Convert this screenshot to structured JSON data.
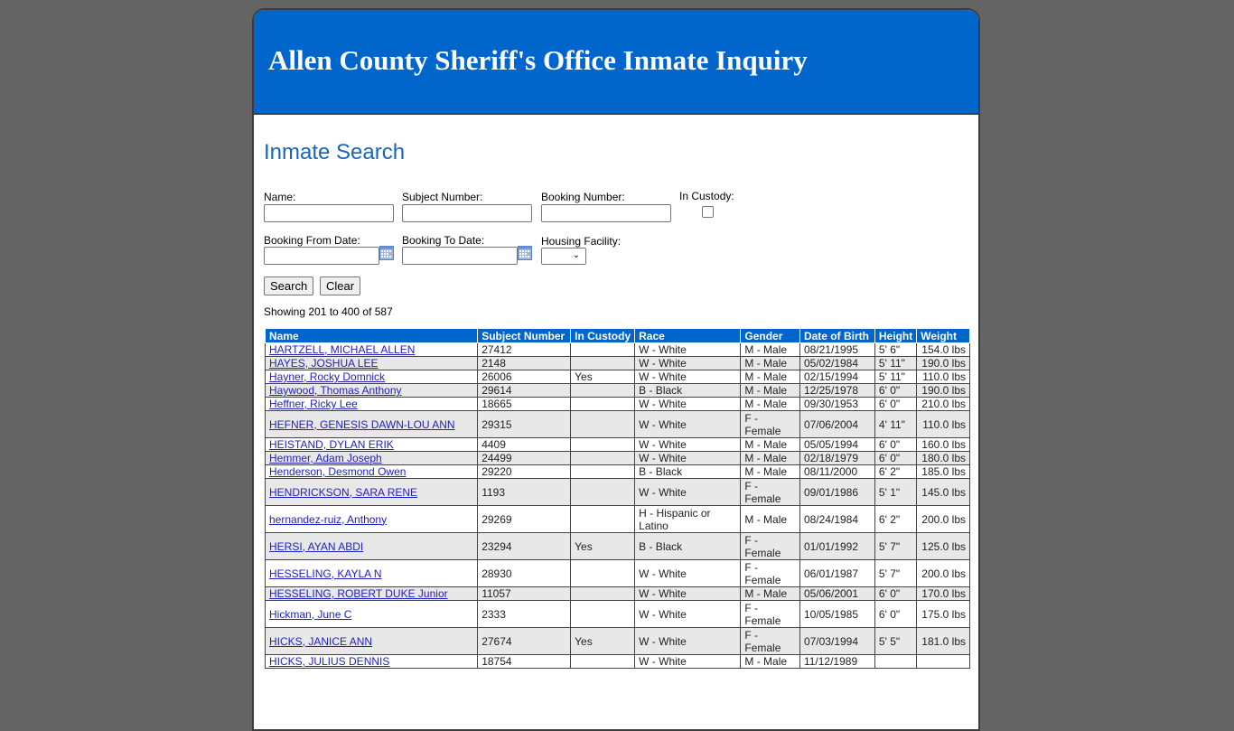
{
  "header": {
    "title": "Allen County Sheriff's Office Inmate Inquiry"
  },
  "search": {
    "section_title": "Inmate Search",
    "fields": {
      "name": {
        "label": "Name:",
        "value": ""
      },
      "subject_number": {
        "label": "Subject Number:",
        "value": ""
      },
      "booking_number": {
        "label": "Booking Number:",
        "value": ""
      },
      "in_custody": {
        "label": "In Custody:",
        "checked": false
      },
      "booking_from_date": {
        "label": "Booking From Date:",
        "value": ""
      },
      "booking_to_date": {
        "label": "Booking To Date:",
        "value": ""
      },
      "housing_facility": {
        "label": "Housing Facility:",
        "selected": ""
      }
    },
    "buttons": {
      "search": "Search",
      "clear": "Clear"
    },
    "icons": {
      "calendar": "calendar-icon",
      "dropdown": "chevron-down-icon"
    }
  },
  "results": {
    "summary": "Showing 201 to 400 of 587",
    "columns": [
      "Name",
      "Subject Number",
      "In Custody",
      "Race",
      "Gender",
      "Date of Birth",
      "Height",
      "Weight"
    ],
    "rows": [
      {
        "name": "HARTZELL, MICHAEL ALLEN",
        "subject": "27412",
        "custody": "",
        "race": "W - White",
        "gender": "M - Male",
        "dob": "08/21/1995",
        "height": "5' 6\"",
        "weight": "154.0 lbs"
      },
      {
        "name": "HAYES, JOSHUA LEE",
        "subject": "2148",
        "custody": "",
        "race": "W - White",
        "gender": "M - Male",
        "dob": "05/02/1984",
        "height": "5' 11\"",
        "weight": "190.0 lbs"
      },
      {
        "name": "Hayner, Rocky Domnick",
        "subject": "26006",
        "custody": "Yes",
        "race": "W - White",
        "gender": "M - Male",
        "dob": "02/15/1994",
        "height": "5' 11\"",
        "weight": "110.0 lbs"
      },
      {
        "name": "Haywood, Thomas Anthony",
        "subject": "29614",
        "custody": "",
        "race": "B - Black",
        "gender": "M - Male",
        "dob": "12/25/1978",
        "height": "6' 0\"",
        "weight": "190.0 lbs"
      },
      {
        "name": "Heffner, Ricky Lee",
        "subject": "18665",
        "custody": "",
        "race": "W - White",
        "gender": "M - Male",
        "dob": "09/30/1953",
        "height": "6' 0\"",
        "weight": "210.0 lbs"
      },
      {
        "name": "HEFNER, GENESIS DAWN-LOU ANN",
        "subject": "29315",
        "custody": "",
        "race": "W - White",
        "gender": "F - Female",
        "dob": "07/06/2004",
        "height": "4' 11\"",
        "weight": "110.0 lbs"
      },
      {
        "name": "HEISTAND, DYLAN ERIK",
        "subject": "4409",
        "custody": "",
        "race": "W - White",
        "gender": "M - Male",
        "dob": "05/05/1994",
        "height": "6' 0\"",
        "weight": "160.0 lbs"
      },
      {
        "name": "Hemmer, Adam Joseph",
        "subject": "24499",
        "custody": "",
        "race": "W - White",
        "gender": "M - Male",
        "dob": "02/18/1979",
        "height": "6' 0\"",
        "weight": "180.0 lbs"
      },
      {
        "name": "Henderson, Desmond Owen",
        "subject": "29220",
        "custody": "",
        "race": "B - Black",
        "gender": "M - Male",
        "dob": "08/11/2000",
        "height": "6' 2\"",
        "weight": "185.0 lbs"
      },
      {
        "name": "HENDRICKSON, SARA RENE",
        "subject": "1193",
        "custody": "",
        "race": "W - White",
        "gender": "F - Female",
        "dob": "09/01/1986",
        "height": "5' 1\"",
        "weight": "145.0 lbs"
      },
      {
        "name": "hernandez-ruiz, Anthony",
        "subject": "29269",
        "custody": "",
        "race": "H - Hispanic or Latino",
        "gender": "M - Male",
        "dob": "08/24/1984",
        "height": "6' 2\"",
        "weight": "200.0 lbs"
      },
      {
        "name": "HERSI, AYAN ABDI",
        "subject": "23294",
        "custody": "Yes",
        "race": "B - Black",
        "gender": "F - Female",
        "dob": "01/01/1992",
        "height": "5' 7\"",
        "weight": "125.0 lbs"
      },
      {
        "name": "HESSELING, KAYLA N",
        "subject": "28930",
        "custody": "",
        "race": "W - White",
        "gender": "F - Female",
        "dob": "06/01/1987",
        "height": "5' 7\"",
        "weight": "200.0 lbs"
      },
      {
        "name": "HESSELING, ROBERT DUKE Junior",
        "subject": "11057",
        "custody": "",
        "race": "W - White",
        "gender": "M - Male",
        "dob": "05/06/2001",
        "height": "6' 0\"",
        "weight": "170.0 lbs"
      },
      {
        "name": "Hickman, June C",
        "subject": "2333",
        "custody": "",
        "race": "W - White",
        "gender": "F - Female",
        "dob": "10/05/1985",
        "height": "6' 0\"",
        "weight": "175.0 lbs"
      },
      {
        "name": "HICKS, JANICE ANN",
        "subject": "27674",
        "custody": "Yes",
        "race": "W - White",
        "gender": "F - Female",
        "dob": "07/03/1994",
        "height": "5' 5\"",
        "weight": "181.0 lbs"
      },
      {
        "name": "HICKS, JULIUS DENNIS",
        "subject": "18754",
        "custody": "",
        "race": "W - White",
        "gender": "M - Male",
        "dob": "11/12/1989",
        "height": "",
        "weight": ""
      }
    ]
  }
}
